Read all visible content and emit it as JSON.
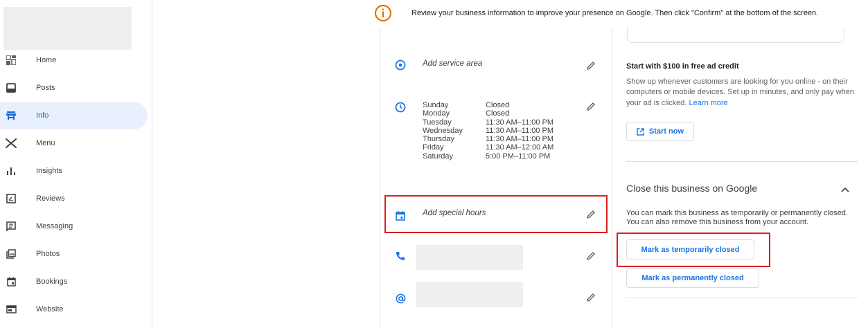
{
  "sidebar": {
    "items": [
      {
        "label": "Home",
        "icon": "dashboard-icon"
      },
      {
        "label": "Posts",
        "icon": "posts-icon"
      },
      {
        "label": "Info",
        "icon": "storefront-icon",
        "active": true
      },
      {
        "label": "Menu",
        "icon": "utensils-icon"
      },
      {
        "label": "Insights",
        "icon": "bar-chart-icon"
      },
      {
        "label": "Reviews",
        "icon": "review-icon"
      },
      {
        "label": "Messaging",
        "icon": "message-icon"
      },
      {
        "label": "Photos",
        "icon": "photos-icon"
      },
      {
        "label": "Bookings",
        "icon": "calendar-icon"
      },
      {
        "label": "Website",
        "icon": "website-icon"
      }
    ]
  },
  "banner": {
    "text": "Review your business information to improve your presence on Google. Then click \"Confirm\" at the bottom of the screen."
  },
  "info": {
    "service_area": "Add service area",
    "hours": [
      {
        "day": "Sunday",
        "time": "Closed"
      },
      {
        "day": "Monday",
        "time": "Closed"
      },
      {
        "day": "Tuesday",
        "time": "11:30 AM–11:00 PM"
      },
      {
        "day": "Wednesday",
        "time": "11:30 AM–11:00 PM"
      },
      {
        "day": "Thursday",
        "time": "11:30 AM–11:00 PM"
      },
      {
        "day": "Friday",
        "time": "11:30 AM–12:00 AM"
      },
      {
        "day": "Saturday",
        "time": "5:00 PM–11:00 PM"
      }
    ],
    "special_hours": "Add special hours"
  },
  "ad": {
    "title": "Start with $100 in free ad credit",
    "description": "Show up whenever customers are looking for you online - on their computers or mobile devices. Set up in minutes, and only pay when your ad is clicked.",
    "learn_more": "Learn more",
    "start_now": "Start now"
  },
  "close_business": {
    "title": "Close this business on Google",
    "description": "You can mark this business as temporarily or permanently closed. You can also remove this business from your account.",
    "temporarily": "Mark as temporarily closed",
    "permanently": "Mark as permanently closed"
  },
  "colors": {
    "accent": "#1a73e8",
    "highlight": "#e01e1e",
    "warning": "#e37400"
  }
}
